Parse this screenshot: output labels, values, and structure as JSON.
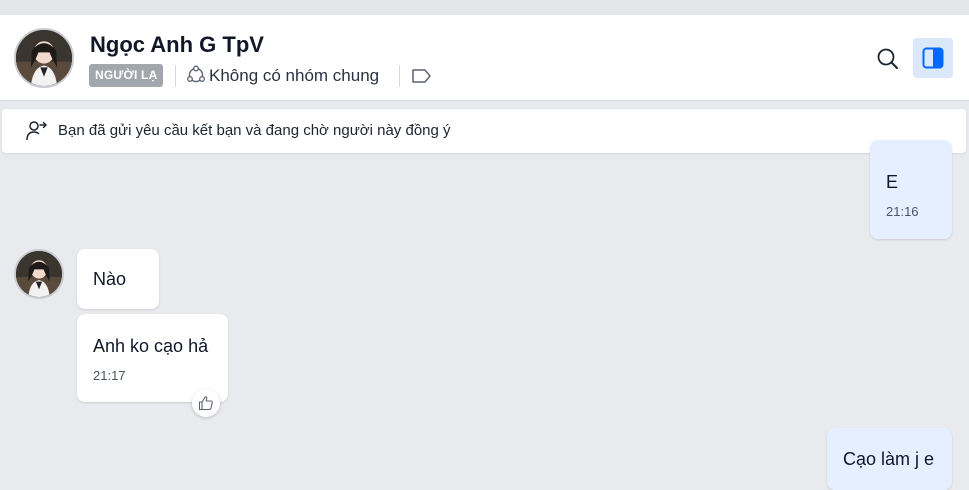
{
  "header": {
    "contact_name": "Ngọc Anh G TpV",
    "stranger_badge": "NGƯỜI LẠ",
    "group_status": "Không có nhóm chung",
    "icons": {
      "avatar": "contact-avatar",
      "group": "group-icon",
      "tag": "tag-icon",
      "search": "search-icon",
      "panel": "sidebar-toggle-icon"
    }
  },
  "banner": {
    "text": "Bạn đã gửi yêu cầu kết bạn và đang chờ người này đồng ý",
    "icon": "user-add-icon"
  },
  "messages": [
    {
      "direction": "out",
      "text": "E",
      "time": "21:16"
    },
    {
      "direction": "in",
      "text": "Nào",
      "time": ""
    },
    {
      "direction": "in",
      "text": "Anh ko cạo hả",
      "time": "21:17"
    },
    {
      "direction": "out",
      "text": "Cạo làm j e",
      "time": ""
    }
  ],
  "colors": {
    "outgoing_bubble": "#e5efff",
    "incoming_bubble": "#ffffff",
    "chat_background": "#e9eaee",
    "badge": "#a2a6ad",
    "accent": "#0068ff"
  }
}
